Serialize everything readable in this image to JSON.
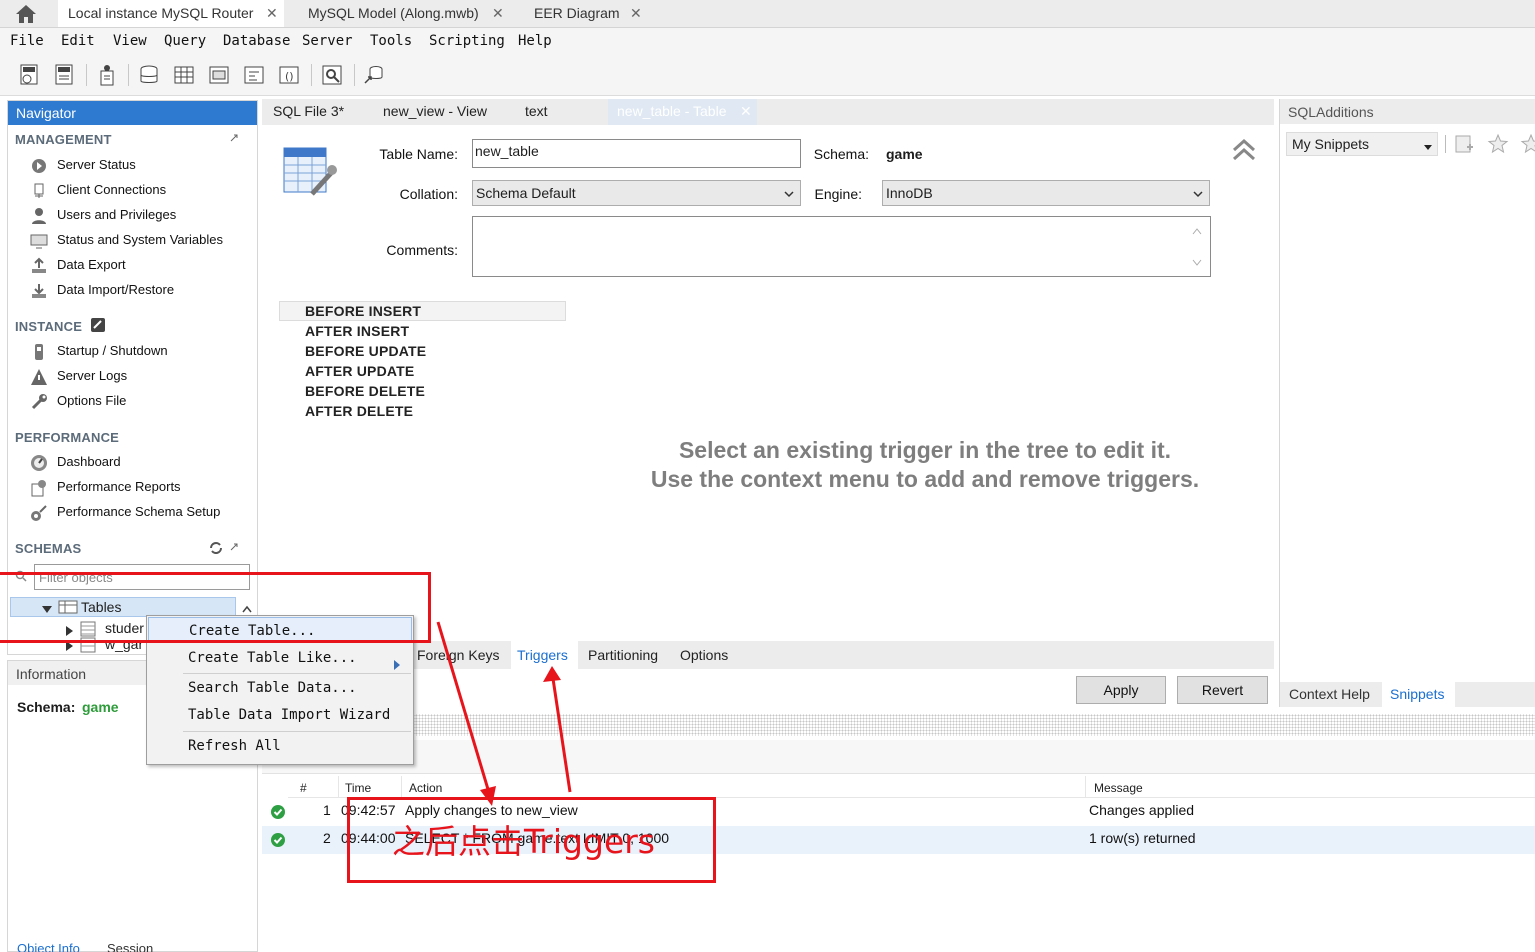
{
  "title_tabs": [
    {
      "label": "Local instance MySQL Router",
      "active": true
    },
    {
      "label": "MySQL Model (Along.mwb)",
      "active": false
    },
    {
      "label": "EER Diagram",
      "active": false
    }
  ],
  "menubar": [
    "File",
    "Edit",
    "View",
    "Query",
    "Database",
    "Server",
    "Tools",
    "Scripting",
    "Help"
  ],
  "navigator": {
    "header": "Navigator",
    "management": {
      "title": "MANAGEMENT",
      "items": [
        "Server Status",
        "Client Connections",
        "Users and Privileges",
        "Status and System Variables",
        "Data Export",
        "Data Import/Restore"
      ]
    },
    "instance": {
      "title": "INSTANCE",
      "items": [
        "Startup / Shutdown",
        "Server Logs",
        "Options File"
      ]
    },
    "performance": {
      "title": "PERFORMANCE",
      "items": [
        "Dashboard",
        "Performance Reports",
        "Performance Schema Setup"
      ]
    },
    "schemas": {
      "title": "SCHEMAS",
      "filter_placeholder": "Filter objects",
      "tree": {
        "tables": "Tables",
        "children": [
          "studer",
          "w_gar"
        ]
      }
    }
  },
  "information": {
    "header": "Information",
    "schema_label": "Schema:",
    "schema_value": "game",
    "bottom_tabs": [
      "Object Info",
      "Session"
    ]
  },
  "editor_tabs": [
    "SQL File 3*",
    "new_view - View",
    "text",
    "new_table - Table"
  ],
  "table_form": {
    "table_name_label": "Table Name:",
    "table_name_value": "new_table",
    "schema_label": "Schema:",
    "schema_value": "game",
    "collation_label": "Collation:",
    "collation_value": "Schema Default",
    "engine_label": "Engine:",
    "engine_value": "InnoDB",
    "comments_label": "Comments:"
  },
  "triggers": [
    "BEFORE INSERT",
    "AFTER INSERT",
    "BEFORE UPDATE",
    "AFTER UPDATE",
    "BEFORE DELETE",
    "AFTER DELETE"
  ],
  "trigger_hint": [
    "Select an existing trigger in the tree to edit it.",
    "Use the context menu to add and remove triggers."
  ],
  "subtabs": [
    "Foreign Keys",
    "Triggers",
    "Partitioning",
    "Options"
  ],
  "buttons": {
    "apply": "Apply",
    "revert": "Revert"
  },
  "output": {
    "columns": [
      "#",
      "Time",
      "Action",
      "Message"
    ],
    "rows": [
      {
        "num": "1",
        "time": "09:42:57",
        "action": "Apply changes to new_view",
        "message": "Changes applied"
      },
      {
        "num": "2",
        "time": "09:44:00",
        "action": "SELECT * FROM game.text LIMIT 0, 1000",
        "message": "1 row(s) returned"
      }
    ]
  },
  "sql_additions": {
    "header": "SQLAdditions",
    "snippets_select": "My Snippets",
    "tabs": [
      "Context Help",
      "Snippets"
    ]
  },
  "context_menu": [
    "Create Table...",
    "Create Table Like...",
    "Search Table Data...",
    "Table Data Import Wizard",
    "Refresh All"
  ],
  "annotation_text": "之后点击Triggers",
  "colors": {
    "accent": "#2e7ad0",
    "annotation": "#e8141c",
    "link": "#1a6fd0"
  }
}
